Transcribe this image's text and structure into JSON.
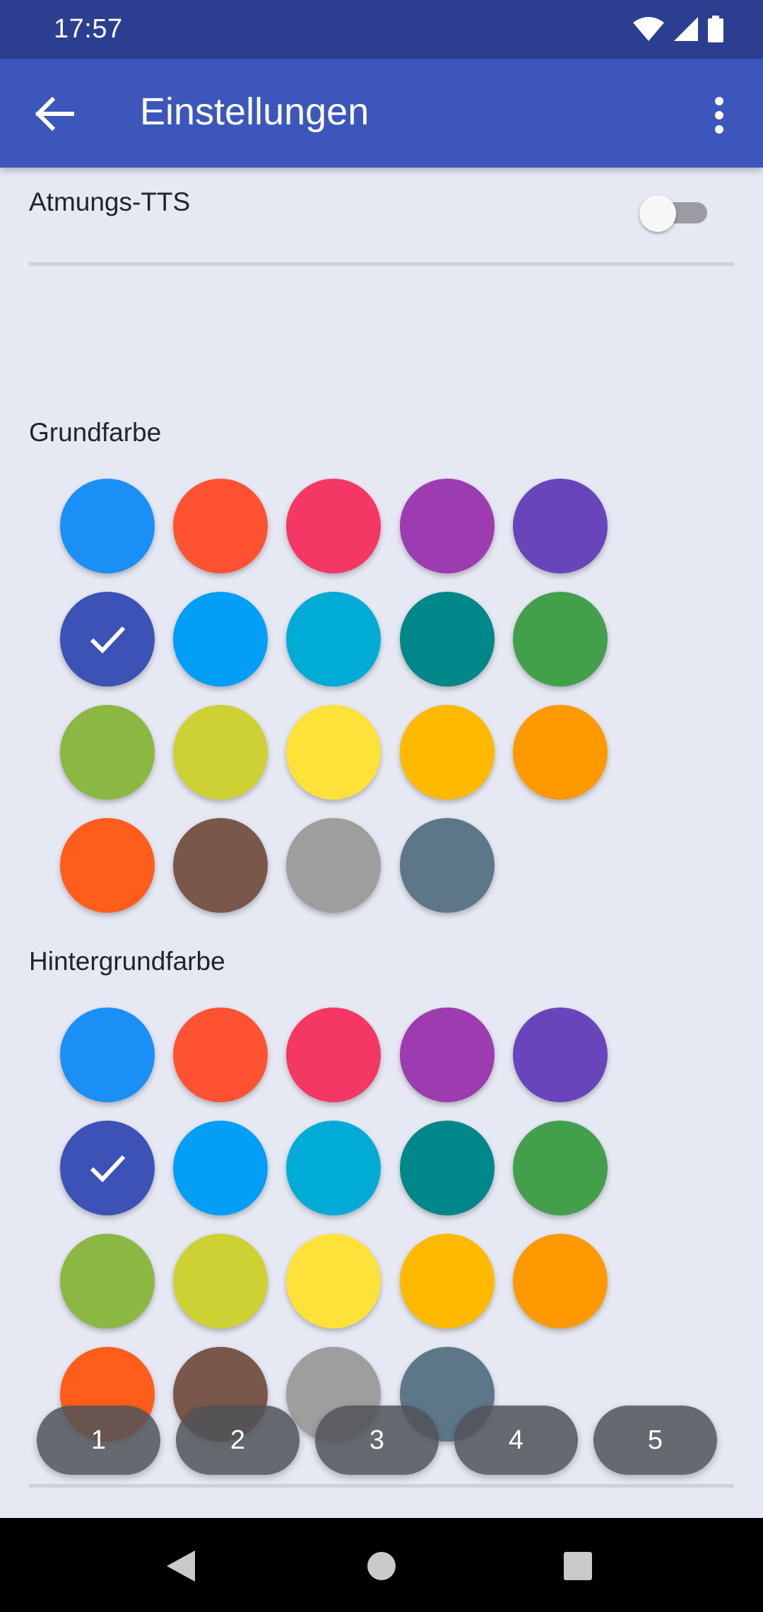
{
  "status_bar": {
    "time": "17:57",
    "icons": [
      "wifi-icon",
      "cell-signal-icon",
      "battery-icon"
    ]
  },
  "app_bar": {
    "title": "Einstellungen",
    "back_icon": "arrow-left-icon",
    "menu_icon": "more-vertical-icon"
  },
  "tts_setting": {
    "label": "Atmungs-TTS",
    "enabled": false
  },
  "color_palette": [
    "#1a8ff5",
    "#ff5233",
    "#f43764",
    "#9d3bb0",
    "#6945bb",
    "#3c52b7",
    "#039ef5",
    "#00acd6",
    "#00878a",
    "#42a04b",
    "#8bb743",
    "#cdd133",
    "#fee23a",
    "#ffb900",
    "#ff9900",
    "#ff5d1b",
    "#79574a",
    "#9e9e9e",
    "#5e7788"
  ],
  "sections": [
    {
      "label": "Grundfarbe",
      "selected_index": 5
    },
    {
      "label": "Hintergrundfarbe",
      "selected_index": 5
    }
  ],
  "pager_buttons": [
    "1",
    "2",
    "3",
    "4",
    "5"
  ],
  "nav_bar": {
    "buttons": [
      "back-triangle-icon",
      "home-circle-icon",
      "recents-square-icon"
    ]
  }
}
